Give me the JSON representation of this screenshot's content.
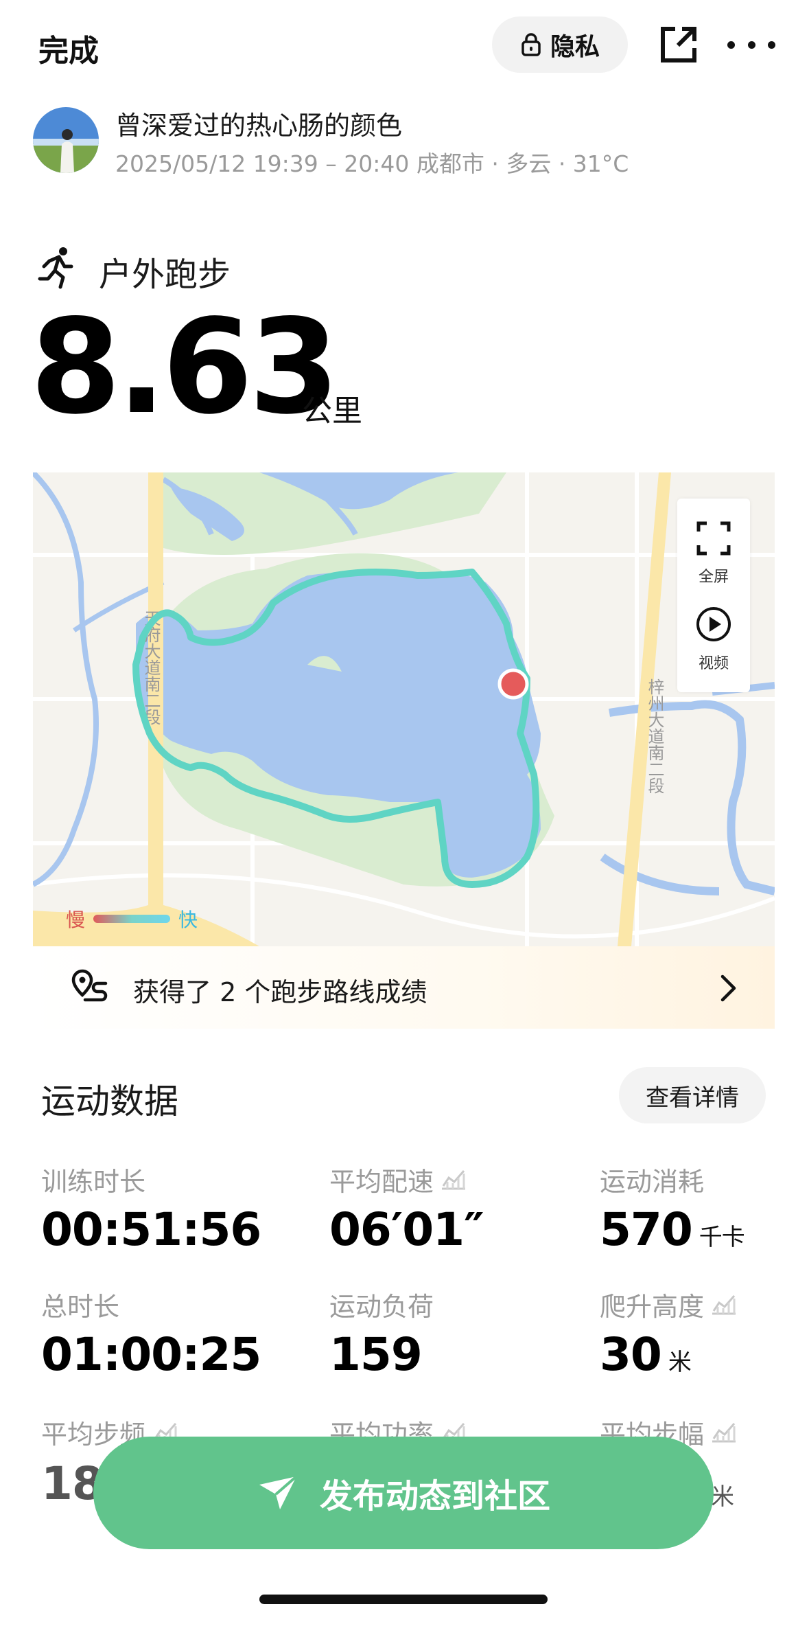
{
  "header": {
    "done_label": "完成",
    "privacy_label": "隐私",
    "icons": [
      "lock-icon",
      "share-icon",
      "more-icon"
    ]
  },
  "user": {
    "name": "曾深爱过的热心肠的颜色",
    "meta": "2025/05/12 19:39 – 20:40 成都市 · 多云 · 31°C"
  },
  "activity": {
    "type": "户外跑步",
    "distance": "8.63",
    "distance_unit": "公里"
  },
  "map": {
    "road_label_left": "天府大道南二段",
    "road_label_right": "梓州大道南二段",
    "controls": {
      "fullscreen_label": "全屏",
      "video_label": "视频"
    },
    "legend": {
      "slow": "慢",
      "fast": "快"
    },
    "colors": {
      "water": "#a8c6ef",
      "park": "#d9ecd0",
      "route": "#5fd4c4",
      "road": "#fbe7a9",
      "start_marker": "#e55b5b"
    }
  },
  "achievement": {
    "text": "获得了 2 个跑步路线成绩"
  },
  "stats_section": {
    "title": "运动数据",
    "details_label": "查看详情",
    "items": [
      {
        "label": "训练时长",
        "value": "00:51:56",
        "unit": ""
      },
      {
        "label": "平均配速",
        "value": "06′01″",
        "unit": ""
      },
      {
        "label": "运动消耗",
        "value": "570",
        "unit": "千卡"
      },
      {
        "label": "总时长",
        "value": "01:00:25",
        "unit": ""
      },
      {
        "label": "运动负荷",
        "value": "159",
        "unit": ""
      },
      {
        "label": "爬升高度",
        "value": "30",
        "unit": "米"
      },
      {
        "label": "平均步频",
        "value": "188",
        "unit": ""
      },
      {
        "label": "平均功率",
        "value": "",
        "unit": ""
      },
      {
        "label": "平均步幅",
        "value": "",
        "unit": "米"
      }
    ]
  },
  "cta": {
    "label": "发布动态到社区"
  },
  "colors": {
    "accent": "#61c48c",
    "muted_text": "#9a9a9a"
  }
}
